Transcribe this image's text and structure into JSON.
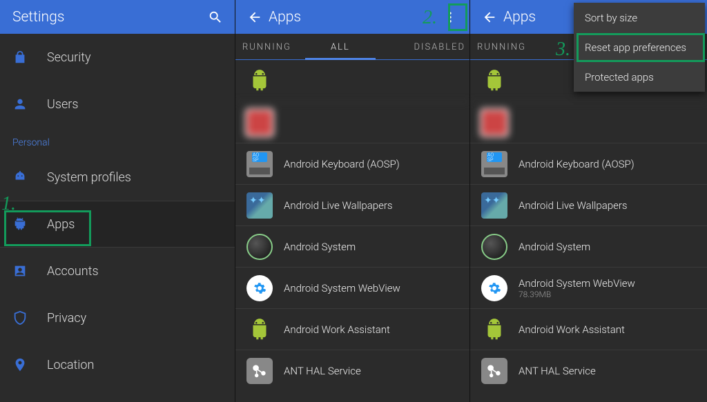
{
  "settings_panel": {
    "title": "Settings",
    "items_top": [
      {
        "label": "Security",
        "icon": "lock"
      },
      {
        "label": "Users",
        "icon": "user"
      }
    ],
    "section": "Personal",
    "items_personal": [
      {
        "label": "System profiles",
        "icon": "robot"
      },
      {
        "label": "Apps",
        "icon": "droid",
        "selected": true
      },
      {
        "label": "Accounts",
        "icon": "account-box"
      },
      {
        "label": "Privacy",
        "icon": "shield"
      },
      {
        "label": "Location",
        "icon": "pin"
      }
    ]
  },
  "apps_panel_a": {
    "title": "Apps",
    "tabs": {
      "running": "RUNNING",
      "all": "ALL",
      "disabled": "DISABLED"
    },
    "list": [
      {
        "label": "",
        "icon": "android-green"
      },
      {
        "label": "",
        "icon": "blurred"
      },
      {
        "label": "Android Keyboard (AOSP)",
        "icon": "aosp"
      },
      {
        "label": "Android Live Wallpapers",
        "icon": "livewall"
      },
      {
        "label": "Android System",
        "icon": "sys"
      },
      {
        "label": "Android System WebView",
        "icon": "webview"
      },
      {
        "label": "Android Work Assistant",
        "icon": "android-green"
      },
      {
        "label": "ANT HAL Service",
        "icon": "ant"
      }
    ]
  },
  "apps_panel_b": {
    "title": "Apps",
    "tabs": {
      "running": "RUNNING"
    },
    "list": [
      {
        "label": "",
        "icon": "android-green"
      },
      {
        "label": "",
        "icon": "blurred"
      },
      {
        "label": "Android Keyboard (AOSP)",
        "icon": "aosp"
      },
      {
        "label": "Android Live Wallpapers",
        "icon": "livewall"
      },
      {
        "label": "Android System",
        "icon": "sys"
      },
      {
        "label": "Android System WebView",
        "sub": "78.39MB",
        "icon": "webview"
      },
      {
        "label": "Android Work Assistant",
        "icon": "android-green"
      },
      {
        "label": "ANT HAL Service",
        "icon": "ant"
      }
    ]
  },
  "overflow_menu": {
    "items": [
      "Sort by size",
      "Reset app preferences",
      "Protected apps"
    ]
  },
  "annotations": {
    "one": "1.",
    "two": "2.",
    "three": "3."
  }
}
